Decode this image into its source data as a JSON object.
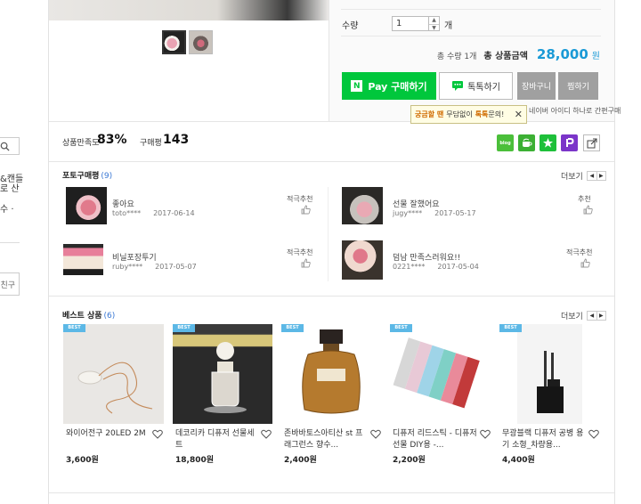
{
  "left_panel": {
    "line1": "&캔들",
    "line2": "로 산",
    "line3": "수 ·",
    "button": "친구"
  },
  "purchase": {
    "qty_label": "수량",
    "qty_value": "1",
    "qty_unit": "개",
    "total_count": "총 수량 1개",
    "total_label": "총 상품금액",
    "total_price": "28,000",
    "total_won": "원",
    "npay_label": "Pay 구매하기",
    "npay_n": "N",
    "talk_label": "톡톡하기",
    "cart_label": "장바구니",
    "wish_label": "찜하기",
    "tooltip_a": "궁금할 땐",
    "tooltip_b": "무담없이",
    "tooltip_c": "톡톡",
    "tooltip_d": "문의!",
    "naver_note": "네이버 아이디 하나로 간편구매"
  },
  "stats": {
    "satisfaction_label": "상품만족도",
    "satisfaction_value": "83%",
    "review_label": "구매평",
    "review_value": "143"
  },
  "share": {
    "blog": "blog",
    "icons": [
      "blog-icon",
      "cafe-icon",
      "star-icon",
      "p-icon",
      "share-icon"
    ]
  },
  "photo_reviews": {
    "title": "포토구매평",
    "count": "(9)",
    "more": "더보기",
    "items": [
      {
        "title": "좋아요",
        "user": "toto****",
        "date": "2017-06-14",
        "rec": "적극추천"
      },
      {
        "title": "선물 잘했어요",
        "user": "jugy****",
        "date": "2017-05-17",
        "rec": "추천"
      },
      {
        "title": "비닐포장투기",
        "user": "ruby****",
        "date": "2017-05-07",
        "rec": "적극추천"
      },
      {
        "title": "덤남 만족스러워요!!",
        "user": "0221****",
        "date": "2017-05-04",
        "rec": "적극추천"
      }
    ]
  },
  "best": {
    "title": "베스트 상품",
    "count": "(6)",
    "more": "더보기",
    "badge": "BEST",
    "items": [
      {
        "name": "와이어전구 20LED 2M",
        "price": "3,600원"
      },
      {
        "name": "데코리카 디퓨저 선물세트",
        "price": "18,800원"
      },
      {
        "name": "존바바토스아티산 st 프래그런스 향수...",
        "price": "2,400원"
      },
      {
        "name": "디퓨저 리드스틱 - 디퓨저 선물 DIY용 -...",
        "price": "2,200원"
      },
      {
        "name": "무광블랙 디퓨저 공병 용기 소형_차량용...",
        "price": "4,400원"
      }
    ]
  },
  "colors": {
    "npay_green": "#00c73c",
    "price_blue": "#1a9ad6",
    "badge_blue": "#5cb8e6",
    "count_blue": "#3a78d4"
  }
}
